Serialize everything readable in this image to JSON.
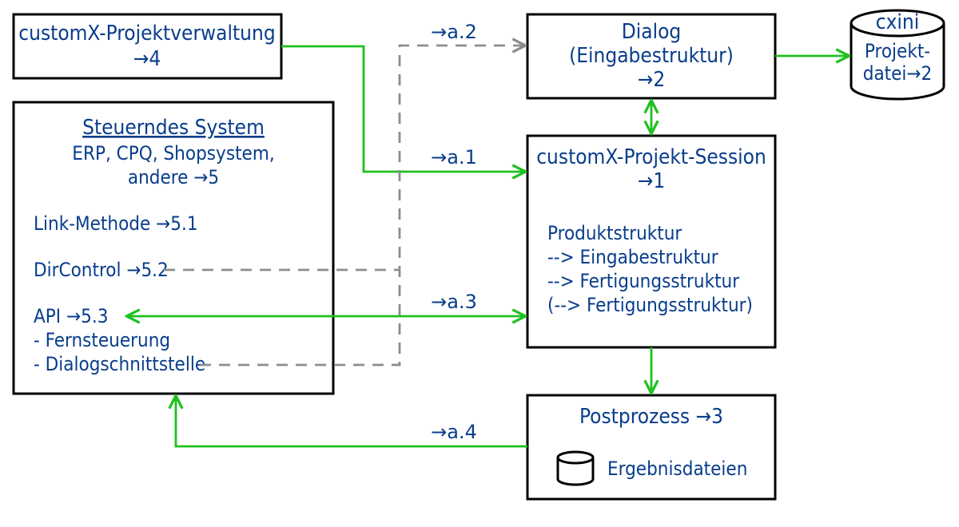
{
  "nodes": {
    "pv": {
      "title": "customX-Projektverwaltung",
      "ref": "→4"
    },
    "dialog": {
      "line1": "Dialog",
      "line2": "(Eingabestruktur)",
      "ref": "→2"
    },
    "cxini": {
      "title": "cxini",
      "l1": "Projekt-",
      "l2": "datei→2"
    },
    "steuer": {
      "title": "Steuerndes System",
      "sub1": "ERP, CPQ, Shopsystem,",
      "sub2": "andere →5",
      "link": "Link-Methode →5.1",
      "dir": "DirControl →5.2",
      "api": "API →5.3",
      "api1": "- Fernsteuerung",
      "api2": "- Dialogschnittstelle"
    },
    "session": {
      "title": "customX-Projekt-Session",
      "ref": "→1",
      "b1": "Produktstruktur",
      "b2": "--> Eingabestruktur",
      "b3": "--> Fertigungsstruktur",
      "b4": "(--> Fertigungsstruktur)"
    },
    "post": {
      "title": "Postprozess →3",
      "sub": "Ergebnisdateien"
    }
  },
  "edges": {
    "a1": "→a.1",
    "a2": "→a.2",
    "a3": "→a.3",
    "a4": "→a.4"
  }
}
